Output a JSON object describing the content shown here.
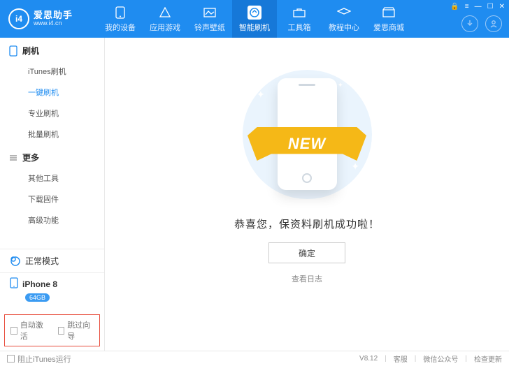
{
  "brand": {
    "name": "爱思助手",
    "url": "www.i4.cn",
    "logo_text": "i4"
  },
  "nav": {
    "items": [
      {
        "label": "我的设备"
      },
      {
        "label": "应用游戏"
      },
      {
        "label": "铃声壁纸"
      },
      {
        "label": "智能刷机",
        "active": true
      },
      {
        "label": "工具箱"
      },
      {
        "label": "教程中心"
      },
      {
        "label": "爱思商城"
      }
    ]
  },
  "sidebar": {
    "sections": [
      {
        "title": "刷机",
        "items": [
          {
            "label": "iTunes刷机"
          },
          {
            "label": "一键刷机",
            "active": true
          },
          {
            "label": "专业刷机"
          },
          {
            "label": "批量刷机"
          }
        ]
      },
      {
        "title": "更多",
        "items": [
          {
            "label": "其他工具"
          },
          {
            "label": "下载固件"
          },
          {
            "label": "高级功能"
          }
        ]
      }
    ],
    "mode": {
      "label": "正常模式"
    },
    "device": {
      "name": "iPhone 8",
      "badge": "64GB"
    },
    "checks": {
      "auto_activate": "自动激活",
      "skip_guide": "跳过向导"
    }
  },
  "main": {
    "ribbon": "NEW",
    "success_text": "恭喜您，保资料刷机成功啦！",
    "ok_label": "确定",
    "log_link": "查看日志"
  },
  "footer": {
    "block_itunes": "阻止iTunes运行",
    "version": "V8.12",
    "links": [
      "客服",
      "微信公众号",
      "检查更新"
    ]
  }
}
